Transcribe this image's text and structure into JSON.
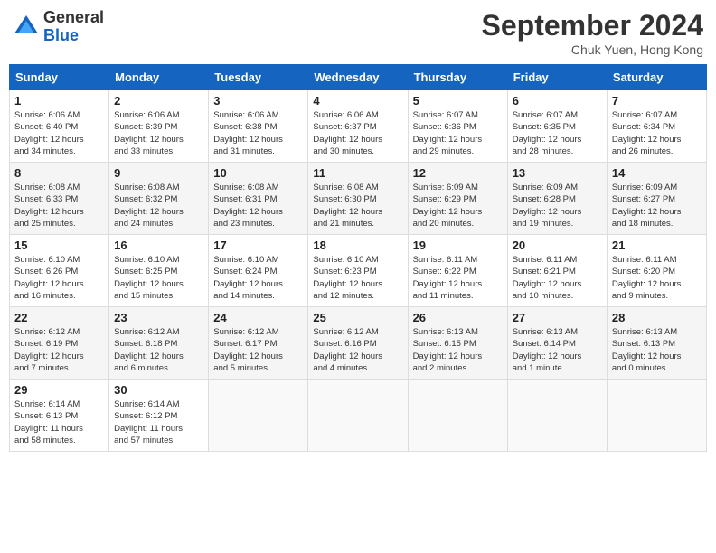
{
  "header": {
    "logo_general": "General",
    "logo_blue": "Blue",
    "title": "September 2024",
    "subtitle": "Chuk Yuen, Hong Kong"
  },
  "days_of_week": [
    "Sunday",
    "Monday",
    "Tuesday",
    "Wednesday",
    "Thursday",
    "Friday",
    "Saturday"
  ],
  "weeks": [
    [
      {
        "day": "1",
        "sunrise": "6:06 AM",
        "sunset": "6:40 PM",
        "daylight": "12 hours and 34 minutes."
      },
      {
        "day": "2",
        "sunrise": "6:06 AM",
        "sunset": "6:39 PM",
        "daylight": "12 hours and 33 minutes."
      },
      {
        "day": "3",
        "sunrise": "6:06 AM",
        "sunset": "6:38 PM",
        "daylight": "12 hours and 31 minutes."
      },
      {
        "day": "4",
        "sunrise": "6:06 AM",
        "sunset": "6:37 PM",
        "daylight": "12 hours and 30 minutes."
      },
      {
        "day": "5",
        "sunrise": "6:07 AM",
        "sunset": "6:36 PM",
        "daylight": "12 hours and 29 minutes."
      },
      {
        "day": "6",
        "sunrise": "6:07 AM",
        "sunset": "6:35 PM",
        "daylight": "12 hours and 28 minutes."
      },
      {
        "day": "7",
        "sunrise": "6:07 AM",
        "sunset": "6:34 PM",
        "daylight": "12 hours and 26 minutes."
      }
    ],
    [
      {
        "day": "8",
        "sunrise": "6:08 AM",
        "sunset": "6:33 PM",
        "daylight": "12 hours and 25 minutes."
      },
      {
        "day": "9",
        "sunrise": "6:08 AM",
        "sunset": "6:32 PM",
        "daylight": "12 hours and 24 minutes."
      },
      {
        "day": "10",
        "sunrise": "6:08 AM",
        "sunset": "6:31 PM",
        "daylight": "12 hours and 23 minutes."
      },
      {
        "day": "11",
        "sunrise": "6:08 AM",
        "sunset": "6:30 PM",
        "daylight": "12 hours and 21 minutes."
      },
      {
        "day": "12",
        "sunrise": "6:09 AM",
        "sunset": "6:29 PM",
        "daylight": "12 hours and 20 minutes."
      },
      {
        "day": "13",
        "sunrise": "6:09 AM",
        "sunset": "6:28 PM",
        "daylight": "12 hours and 19 minutes."
      },
      {
        "day": "14",
        "sunrise": "6:09 AM",
        "sunset": "6:27 PM",
        "daylight": "12 hours and 18 minutes."
      }
    ],
    [
      {
        "day": "15",
        "sunrise": "6:10 AM",
        "sunset": "6:26 PM",
        "daylight": "12 hours and 16 minutes."
      },
      {
        "day": "16",
        "sunrise": "6:10 AM",
        "sunset": "6:25 PM",
        "daylight": "12 hours and 15 minutes."
      },
      {
        "day": "17",
        "sunrise": "6:10 AM",
        "sunset": "6:24 PM",
        "daylight": "12 hours and 14 minutes."
      },
      {
        "day": "18",
        "sunrise": "6:10 AM",
        "sunset": "6:23 PM",
        "daylight": "12 hours and 12 minutes."
      },
      {
        "day": "19",
        "sunrise": "6:11 AM",
        "sunset": "6:22 PM",
        "daylight": "12 hours and 11 minutes."
      },
      {
        "day": "20",
        "sunrise": "6:11 AM",
        "sunset": "6:21 PM",
        "daylight": "12 hours and 10 minutes."
      },
      {
        "day": "21",
        "sunrise": "6:11 AM",
        "sunset": "6:20 PM",
        "daylight": "12 hours and 9 minutes."
      }
    ],
    [
      {
        "day": "22",
        "sunrise": "6:12 AM",
        "sunset": "6:19 PM",
        "daylight": "12 hours and 7 minutes."
      },
      {
        "day": "23",
        "sunrise": "6:12 AM",
        "sunset": "6:18 PM",
        "daylight": "12 hours and 6 minutes."
      },
      {
        "day": "24",
        "sunrise": "6:12 AM",
        "sunset": "6:17 PM",
        "daylight": "12 hours and 5 minutes."
      },
      {
        "day": "25",
        "sunrise": "6:12 AM",
        "sunset": "6:16 PM",
        "daylight": "12 hours and 4 minutes."
      },
      {
        "day": "26",
        "sunrise": "6:13 AM",
        "sunset": "6:15 PM",
        "daylight": "12 hours and 2 minutes."
      },
      {
        "day": "27",
        "sunrise": "6:13 AM",
        "sunset": "6:14 PM",
        "daylight": "12 hours and 1 minute."
      },
      {
        "day": "28",
        "sunrise": "6:13 AM",
        "sunset": "6:13 PM",
        "daylight": "12 hours and 0 minutes."
      }
    ],
    [
      {
        "day": "29",
        "sunrise": "6:14 AM",
        "sunset": "6:13 PM",
        "daylight": "11 hours and 58 minutes."
      },
      {
        "day": "30",
        "sunrise": "6:14 AM",
        "sunset": "6:12 PM",
        "daylight": "11 hours and 57 minutes."
      },
      null,
      null,
      null,
      null,
      null
    ]
  ]
}
